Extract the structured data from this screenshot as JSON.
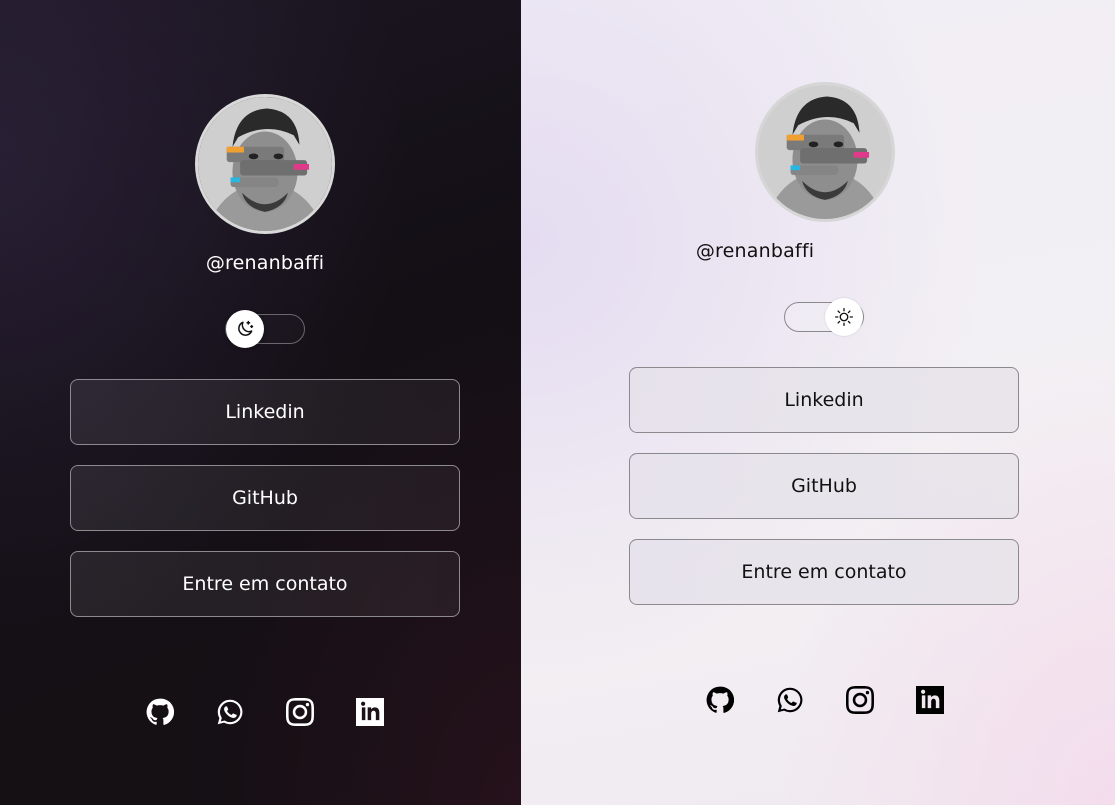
{
  "panels": [
    {
      "theme": "dark",
      "profile": {
        "username": "@renanbaffi"
      },
      "theme_toggle": {
        "state": "dark",
        "icon": "moon-stars-icon"
      },
      "buttons": [
        {
          "label": "Linkedin"
        },
        {
          "label": "GitHub"
        },
        {
          "label": "Entre em contato"
        }
      ],
      "social_icons": [
        "github-icon",
        "whatsapp-icon",
        "instagram-icon",
        "linkedin-icon"
      ],
      "colors": {
        "background": "#151016",
        "text": "#ffffff",
        "border": "#8c898f"
      }
    },
    {
      "theme": "light",
      "profile": {
        "username": "@renanbaffi"
      },
      "theme_toggle": {
        "state": "light",
        "icon": "sun-icon"
      },
      "buttons": [
        {
          "label": "Linkedin"
        },
        {
          "label": "GitHub"
        },
        {
          "label": "Entre em contato"
        }
      ],
      "social_icons": [
        "github-icon",
        "whatsapp-icon",
        "instagram-icon",
        "linkedin-icon"
      ],
      "colors": {
        "background": "#f2eff3",
        "text": "#111111",
        "border": "#8a8a8e"
      }
    }
  ]
}
